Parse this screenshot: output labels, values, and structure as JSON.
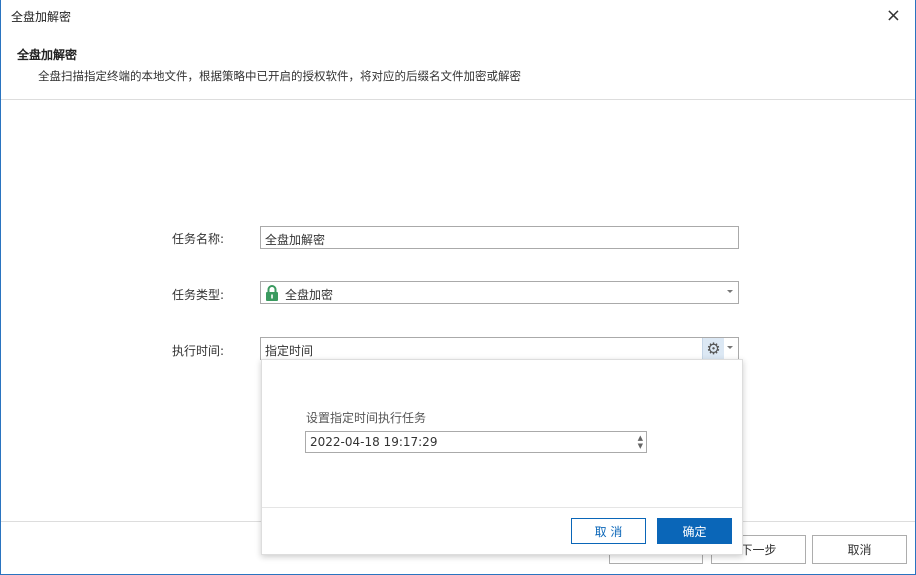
{
  "window": {
    "title": "全盘加解密",
    "close_icon": "×"
  },
  "header": {
    "title": "全盘加解密",
    "description": "全盘扫描指定终端的本地文件，根据策略中已开启的授权软件，将对应的后缀名文件加密或解密"
  },
  "form": {
    "task_name_label": "任务名称:",
    "task_name_value": "全盘加解密",
    "task_type_label": "任务类型:",
    "task_type_value": "全盘加密",
    "exec_time_label": "执行时间:",
    "exec_time_value": "指定时间"
  },
  "popup": {
    "label": "设置指定时间执行任务",
    "datetime": "2022-04-18 19:17:29",
    "cancel": "取 消",
    "ok": "确定"
  },
  "footer": {
    "next": "下一步",
    "cancel": "取消"
  },
  "colors": {
    "accent": "#0a66b8",
    "lock": "#3a9a5f"
  }
}
